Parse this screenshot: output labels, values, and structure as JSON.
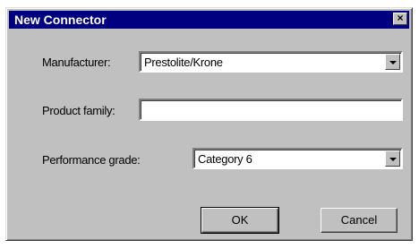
{
  "dialog": {
    "title": "New Connector",
    "close_glyph": "×"
  },
  "form": {
    "manufacturer_label": "Manufacturer:",
    "manufacturer_value": "Prestolite/Krone",
    "product_family_label": "Product family:",
    "product_family_value": "",
    "performance_grade_label": "Performance grade:",
    "performance_grade_value": "Category 6"
  },
  "buttons": {
    "ok_label": "OK",
    "cancel_label": "Cancel"
  },
  "icons": {
    "close": "close-icon",
    "dropdown": "chevron-down-icon"
  }
}
